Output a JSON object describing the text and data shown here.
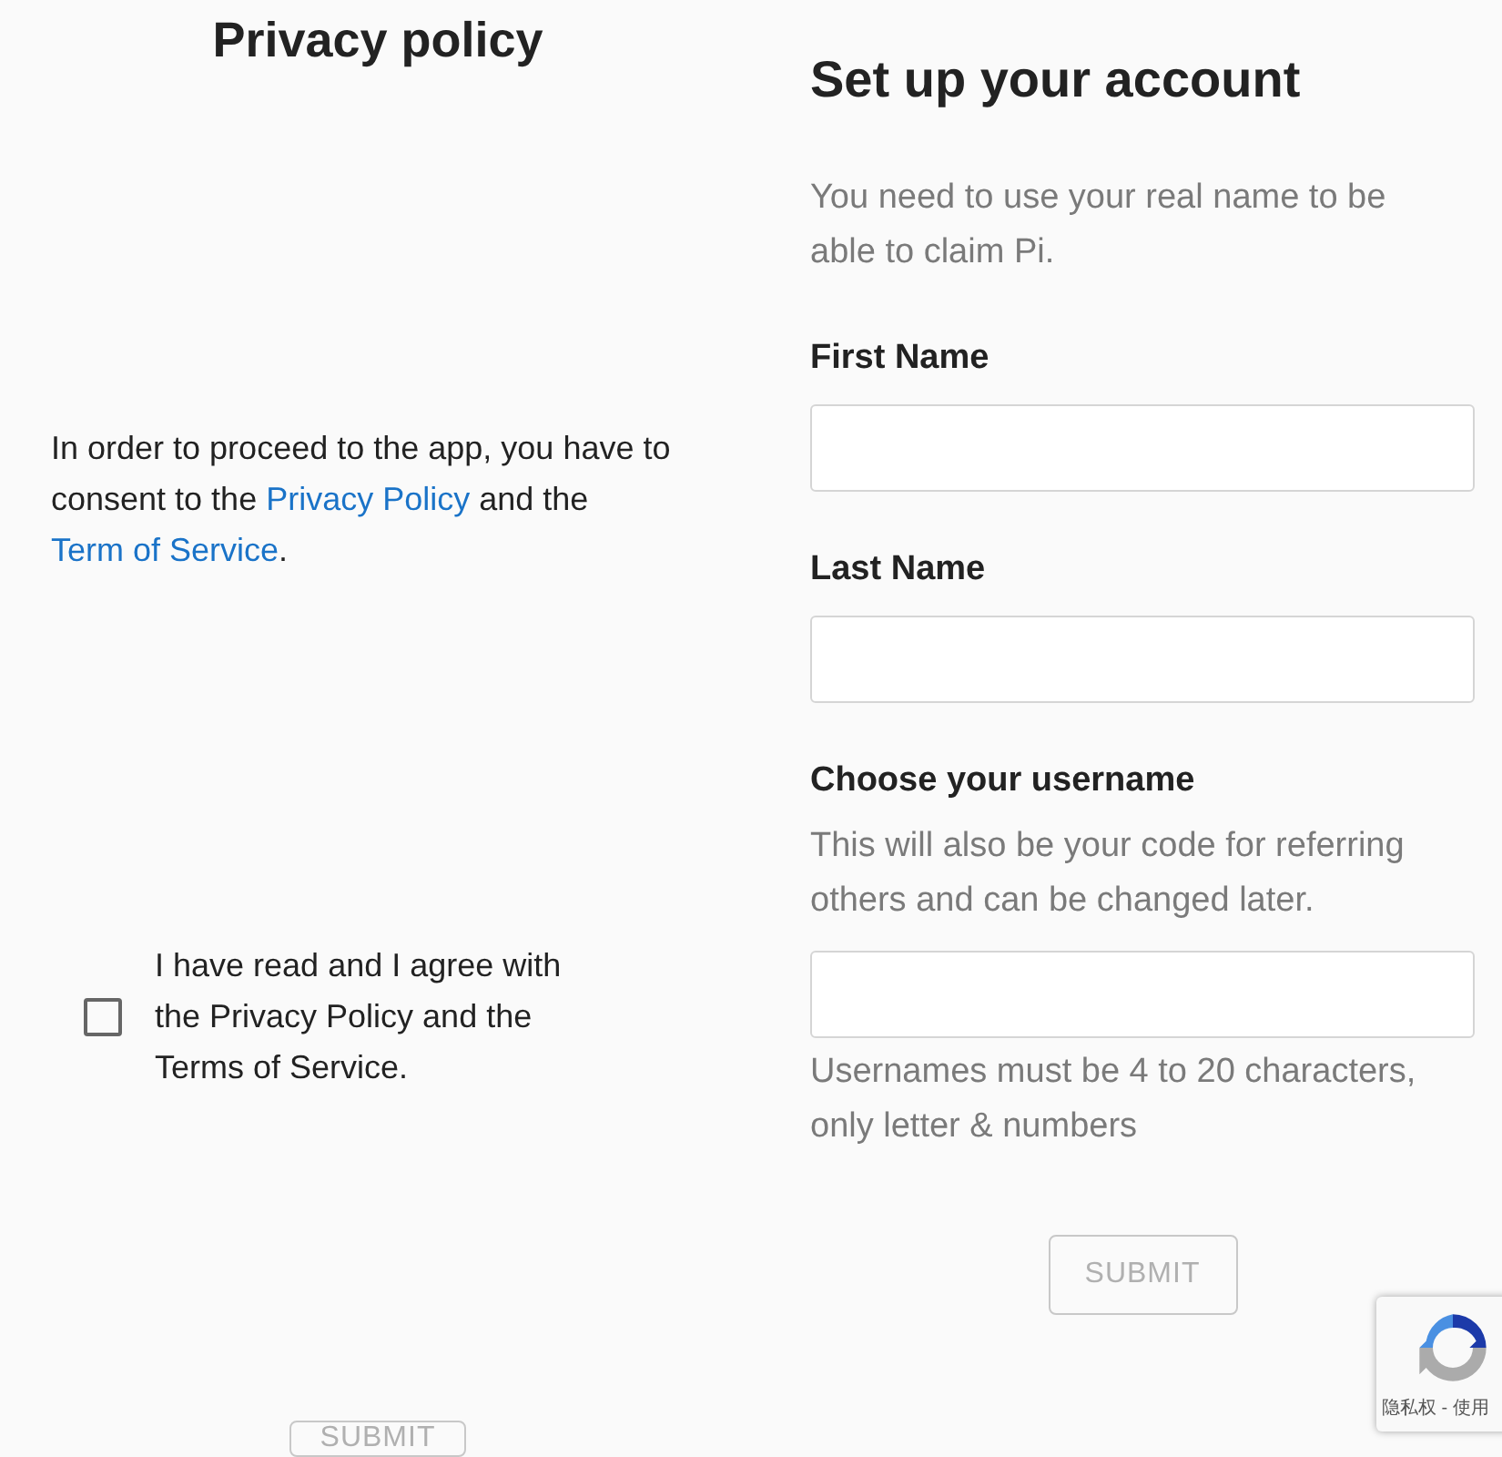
{
  "privacy": {
    "title": "Privacy policy",
    "consent_text": [
      {
        "kind": "text",
        "text": "In order to proceed to the app, you have to consent to the "
      },
      {
        "kind": "link",
        "text": "Privacy Policy"
      },
      {
        "kind": "text",
        "text": " and the "
      },
      {
        "kind": "link",
        "text": "Term of Service"
      },
      {
        "kind": "text",
        "text": "."
      }
    ],
    "agree": {
      "checked": false,
      "label": "I have read and I agree with the Privacy Policy and the Terms of Service."
    },
    "submit": {
      "label": "SUBMIT",
      "disabled": true
    }
  },
  "account": {
    "title": "Set up your account",
    "intro": "You need to use your real name to be able to claim Pi.",
    "fields": [
      {
        "label": "First Name"
      },
      {
        "label": "Last Name"
      },
      {
        "label": "Choose your username",
        "hint": "This will also be your code for referring others and can be changed later.",
        "help": "Usernames must be 4 to 20 characters, only letter & numbers"
      }
    ],
    "submit": {
      "label": "SUBMIT",
      "disabled": true
    }
  },
  "recaptcha": {
    "links": "隐私权 - 使用"
  }
}
